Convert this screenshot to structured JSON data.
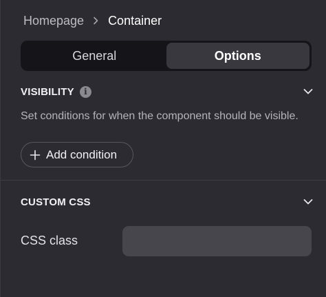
{
  "breadcrumb": {
    "home": "Homepage",
    "current": "Container"
  },
  "tabs": [
    {
      "label": "General",
      "active": false
    },
    {
      "label": "Options",
      "active": true
    }
  ],
  "visibility": {
    "title": "VISIBILITY",
    "info_icon": "info-icon",
    "description": "Set conditions for when the component should be visible.",
    "add_button_label": "Add condition",
    "expanded": true
  },
  "custom_css": {
    "title": "CUSTOM CSS",
    "expanded": true,
    "field_label": "CSS class",
    "field_value": "",
    "field_placeholder": ""
  },
  "colors": {
    "background": "#2c2b31",
    "tab_track": "#151419",
    "tab_active": "#39383f",
    "input_bg": "#47464d"
  }
}
